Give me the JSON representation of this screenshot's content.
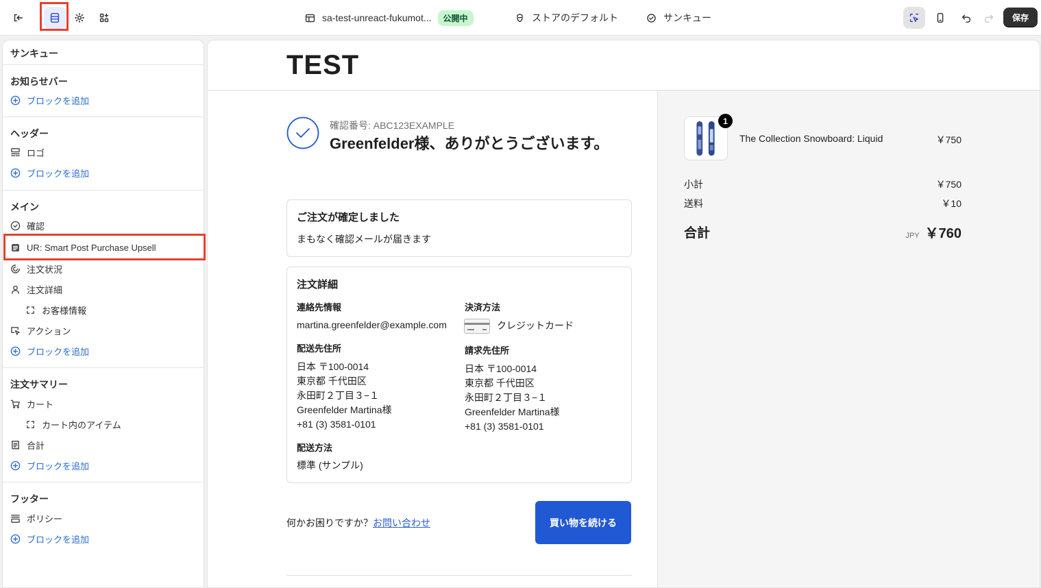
{
  "topbar": {
    "store_name": "sa-test-unreact-fukumot...",
    "status_badge": "公開中",
    "theme": "ストアのデフォルト",
    "page": "サンキュー",
    "save_label": "保存"
  },
  "sidebar": {
    "title": "サンキュー",
    "add_block": "ブロックを追加",
    "sections": {
      "announcement": "お知らせバー",
      "header": "ヘッダー",
      "main": "メイン",
      "summary": "注文サマリー",
      "footer": "フッター"
    },
    "items": {
      "logo": "ロゴ",
      "confirm": "確認",
      "upsell": "UR: Smart Post Purchase Upsell",
      "status": "注文状況",
      "details": "注文詳細",
      "customer": "お客様情報",
      "actions": "アクション",
      "cart": "カート",
      "cart_items": "カート内のアイテム",
      "total": "合計",
      "policy": "ポリシー"
    }
  },
  "preview": {
    "logo": "TEST",
    "confirmation_number": "確認番号: ABC123EXAMPLE",
    "thanks": "Greenfelder様、ありがとうございます。",
    "order_confirmed": {
      "title": "ご注文が確定しました",
      "text": "まもなく確認メールが届きます"
    },
    "order_details": {
      "title": "注文詳細",
      "contact_label": "連絡先情報",
      "contact": "martina.greenfelder@example.com",
      "payment_label": "決済方法",
      "payment": "クレジットカード",
      "shipping_addr_label": "配送先住所",
      "billing_addr_label": "請求先住所",
      "address": [
        "日本 〒100-0014",
        "東京都 千代田区",
        "永田町２丁目３−１",
        "Greenfelder Martina様",
        "+81 (3) 3581-0101"
      ],
      "shipping_method_label": "配送方法",
      "shipping_method": "標準 (サンプル)"
    },
    "help_text": "何かお困りですか？",
    "help_link": "お問い合わせ",
    "continue_button": "買い物を続ける"
  },
  "summary": {
    "quantity": "1",
    "product_name": "The Collection Snowboard: Liquid",
    "product_price": "￥750",
    "subtotal_label": "小計",
    "subtotal": "￥750",
    "shipping_label": "送料",
    "shipping": "￥10",
    "total_label": "合計",
    "currency": "JPY",
    "total": "￥760"
  },
  "colors": {
    "highlight": "#e8412c",
    "accent": "#2158d4",
    "link": "#2c6ecb"
  }
}
